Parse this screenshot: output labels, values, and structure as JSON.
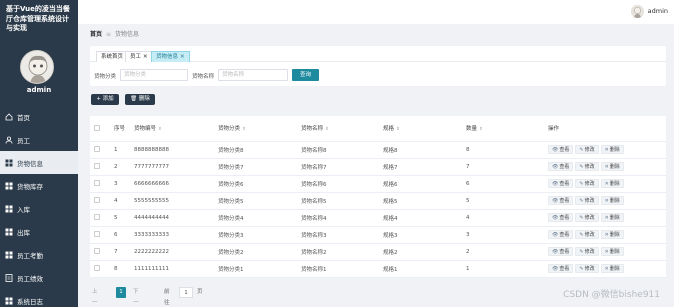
{
  "sidebar": {
    "title": "基于Vue的凌当当餐厅仓库管理系统设计与实现",
    "user": "admin",
    "items": [
      {
        "label": "首页",
        "icon": "home-icon",
        "active": false
      },
      {
        "label": "员工",
        "icon": "user-icon",
        "active": false
      },
      {
        "label": "货物信息",
        "icon": "grid-icon",
        "active": true
      },
      {
        "label": "货物库存",
        "icon": "grid-icon",
        "active": false
      },
      {
        "label": "入库",
        "icon": "grid-icon",
        "active": false
      },
      {
        "label": "出库",
        "icon": "grid-icon",
        "active": false
      },
      {
        "label": "员工考勤",
        "icon": "grid-icon",
        "active": false
      },
      {
        "label": "员工绩效",
        "icon": "document-icon",
        "active": false
      },
      {
        "label": "系统日志",
        "icon": "grid-icon",
        "active": false
      }
    ]
  },
  "header": {
    "user": "admin"
  },
  "breadcrumb": {
    "home": "首页",
    "separator": "≡",
    "current": "货物信息"
  },
  "tabs": [
    {
      "label": "系统首页",
      "closable": false,
      "active": false
    },
    {
      "label": "员工",
      "closable": true,
      "active": false
    },
    {
      "label": "货物信息",
      "closable": true,
      "active": true
    }
  ],
  "filters": {
    "category_label": "货物分类",
    "category_placeholder": "货物分类",
    "name_label": "货物名称",
    "name_placeholder": "货物名称",
    "query_button": "查询"
  },
  "actions": {
    "add": "+ 添加",
    "delete": "🗑 删除"
  },
  "table": {
    "headers": [
      "序号",
      "货物编号",
      "货物分类",
      "货物名称",
      "规格",
      "数量",
      "操作"
    ],
    "rows": [
      [
        "1",
        "8888888888",
        "货物分类8",
        "货物名称8",
        "规格8",
        "8"
      ],
      [
        "2",
        "7777777777",
        "货物分类7",
        "货物名称7",
        "规格7",
        "7"
      ],
      [
        "3",
        "6666666666",
        "货物分类6",
        "货物名称6",
        "规格6",
        "6"
      ],
      [
        "4",
        "5555555555",
        "货物分类5",
        "货物名称5",
        "规格5",
        "5"
      ],
      [
        "5",
        "4444444444",
        "货物分类4",
        "货物名称4",
        "规格4",
        "4"
      ],
      [
        "6",
        "3333333333",
        "货物分类3",
        "货物名称3",
        "规格3",
        "3"
      ],
      [
        "7",
        "2222222222",
        "货物分类2",
        "货物名称2",
        "规格2",
        "2"
      ],
      [
        "8",
        "1111111111",
        "货物分类1",
        "货物名称1",
        "规格1",
        "1"
      ]
    ],
    "ops": [
      "查看",
      "修改",
      "删除"
    ]
  },
  "pager": {
    "prev": "上一页",
    "current": "1",
    "next": "下一页",
    "goto_label": "前往",
    "goto_value": "1",
    "page_unit": "页"
  },
  "watermark": "CSDN @微信bishe911",
  "colors": {
    "sidebar": "#2b3a4a",
    "accent": "#1e8a9e",
    "active_tab": "#c6ecf5"
  }
}
